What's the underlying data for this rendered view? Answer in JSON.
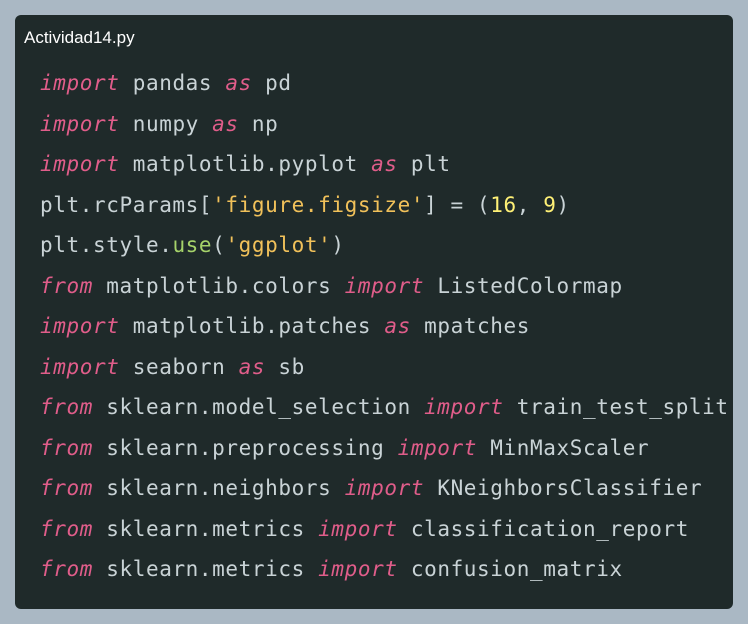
{
  "filename": "Actividad14.py",
  "code_lines": [
    [
      {
        "t": "import",
        "c": "kw"
      },
      {
        "t": " pandas ",
        "c": "plain"
      },
      {
        "t": "as",
        "c": "kw"
      },
      {
        "t": " pd",
        "c": "plain"
      }
    ],
    [
      {
        "t": "import",
        "c": "kw"
      },
      {
        "t": " numpy ",
        "c": "plain"
      },
      {
        "t": "as",
        "c": "kw"
      },
      {
        "t": " np",
        "c": "plain"
      }
    ],
    [
      {
        "t": "import",
        "c": "kw"
      },
      {
        "t": " matplotlib.pyplot ",
        "c": "plain"
      },
      {
        "t": "as",
        "c": "kw"
      },
      {
        "t": " plt",
        "c": "plain"
      }
    ],
    [
      {
        "t": "plt.rcParams[",
        "c": "plain"
      },
      {
        "t": "'figure.figsize'",
        "c": "str"
      },
      {
        "t": "] = (",
        "c": "plain"
      },
      {
        "t": "16",
        "c": "num"
      },
      {
        "t": ", ",
        "c": "plain"
      },
      {
        "t": "9",
        "c": "num"
      },
      {
        "t": ")",
        "c": "plain"
      }
    ],
    [
      {
        "t": "plt.style.",
        "c": "plain"
      },
      {
        "t": "use",
        "c": "fn"
      },
      {
        "t": "(",
        "c": "plain"
      },
      {
        "t": "'ggplot'",
        "c": "str"
      },
      {
        "t": ")",
        "c": "plain"
      }
    ],
    [
      {
        "t": "from",
        "c": "kw"
      },
      {
        "t": " matplotlib.colors ",
        "c": "plain"
      },
      {
        "t": "import",
        "c": "kw"
      },
      {
        "t": " ListedColormap",
        "c": "plain"
      }
    ],
    [
      {
        "t": "import",
        "c": "kw"
      },
      {
        "t": " matplotlib.patches ",
        "c": "plain"
      },
      {
        "t": "as",
        "c": "kw"
      },
      {
        "t": " mpatches",
        "c": "plain"
      }
    ],
    [
      {
        "t": "import",
        "c": "kw"
      },
      {
        "t": " seaborn ",
        "c": "plain"
      },
      {
        "t": "as",
        "c": "kw"
      },
      {
        "t": " sb",
        "c": "plain"
      }
    ],
    [
      {
        "t": "from",
        "c": "kw"
      },
      {
        "t": " sklearn.model_selection ",
        "c": "plain"
      },
      {
        "t": "import",
        "c": "kw"
      },
      {
        "t": " train_test_split",
        "c": "plain"
      }
    ],
    [
      {
        "t": "from",
        "c": "kw"
      },
      {
        "t": " sklearn.preprocessing ",
        "c": "plain"
      },
      {
        "t": "import",
        "c": "kw"
      },
      {
        "t": " MinMaxScaler",
        "c": "plain"
      }
    ],
    [
      {
        "t": "from",
        "c": "kw"
      },
      {
        "t": " sklearn.neighbors ",
        "c": "plain"
      },
      {
        "t": "import",
        "c": "kw"
      },
      {
        "t": " KNeighborsClassifier",
        "c": "plain"
      }
    ],
    [
      {
        "t": "from",
        "c": "kw"
      },
      {
        "t": " sklearn.metrics ",
        "c": "plain"
      },
      {
        "t": "import",
        "c": "kw"
      },
      {
        "t": " classification_report",
        "c": "plain"
      }
    ],
    [
      {
        "t": "from",
        "c": "kw"
      },
      {
        "t": " sklearn.metrics ",
        "c": "plain"
      },
      {
        "t": "import",
        "c": "kw"
      },
      {
        "t": " confusion_matrix",
        "c": "plain"
      }
    ]
  ]
}
